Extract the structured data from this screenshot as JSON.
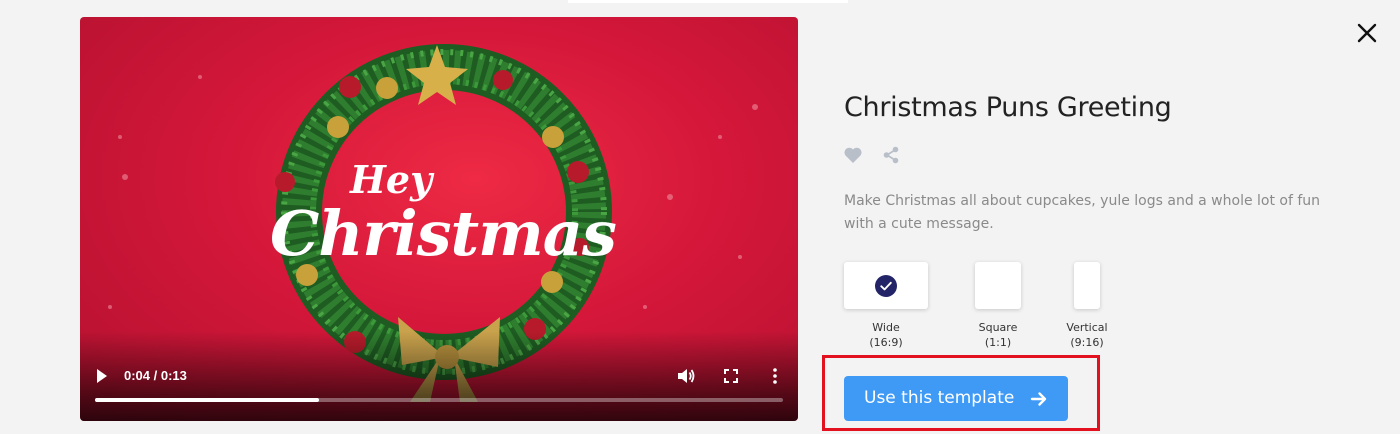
{
  "modal": {
    "close_icon": "close-icon"
  },
  "video": {
    "overlay_line1": "Hey",
    "overlay_line2": "Christmas",
    "time": "0:04 / 0:13",
    "progress_fraction": 0.325,
    "icons": [
      "play-icon",
      "volume-icon",
      "fullscreen-icon",
      "more-vertical-icon"
    ]
  },
  "template": {
    "title": "Christmas Puns Greeting",
    "description": "Make Christmas all about cupcakes, yule logs and a whole lot of fun with a cute message.",
    "actions": [
      "heart-icon",
      "share-icon"
    ]
  },
  "formats": [
    {
      "name": "Wide",
      "ratio": "(16:9)",
      "selected": true
    },
    {
      "name": "Square",
      "ratio": "(1:1)",
      "selected": false
    },
    {
      "name": "Vertical",
      "ratio": "(9:16)",
      "selected": false
    }
  ],
  "cta": {
    "label": "Use this template",
    "icon": "arrow-right-icon"
  },
  "colors": {
    "accent": "#3f9af5",
    "selected_check": "#232467",
    "highlight": "#e3101f",
    "video_bg": "#d4173a"
  }
}
